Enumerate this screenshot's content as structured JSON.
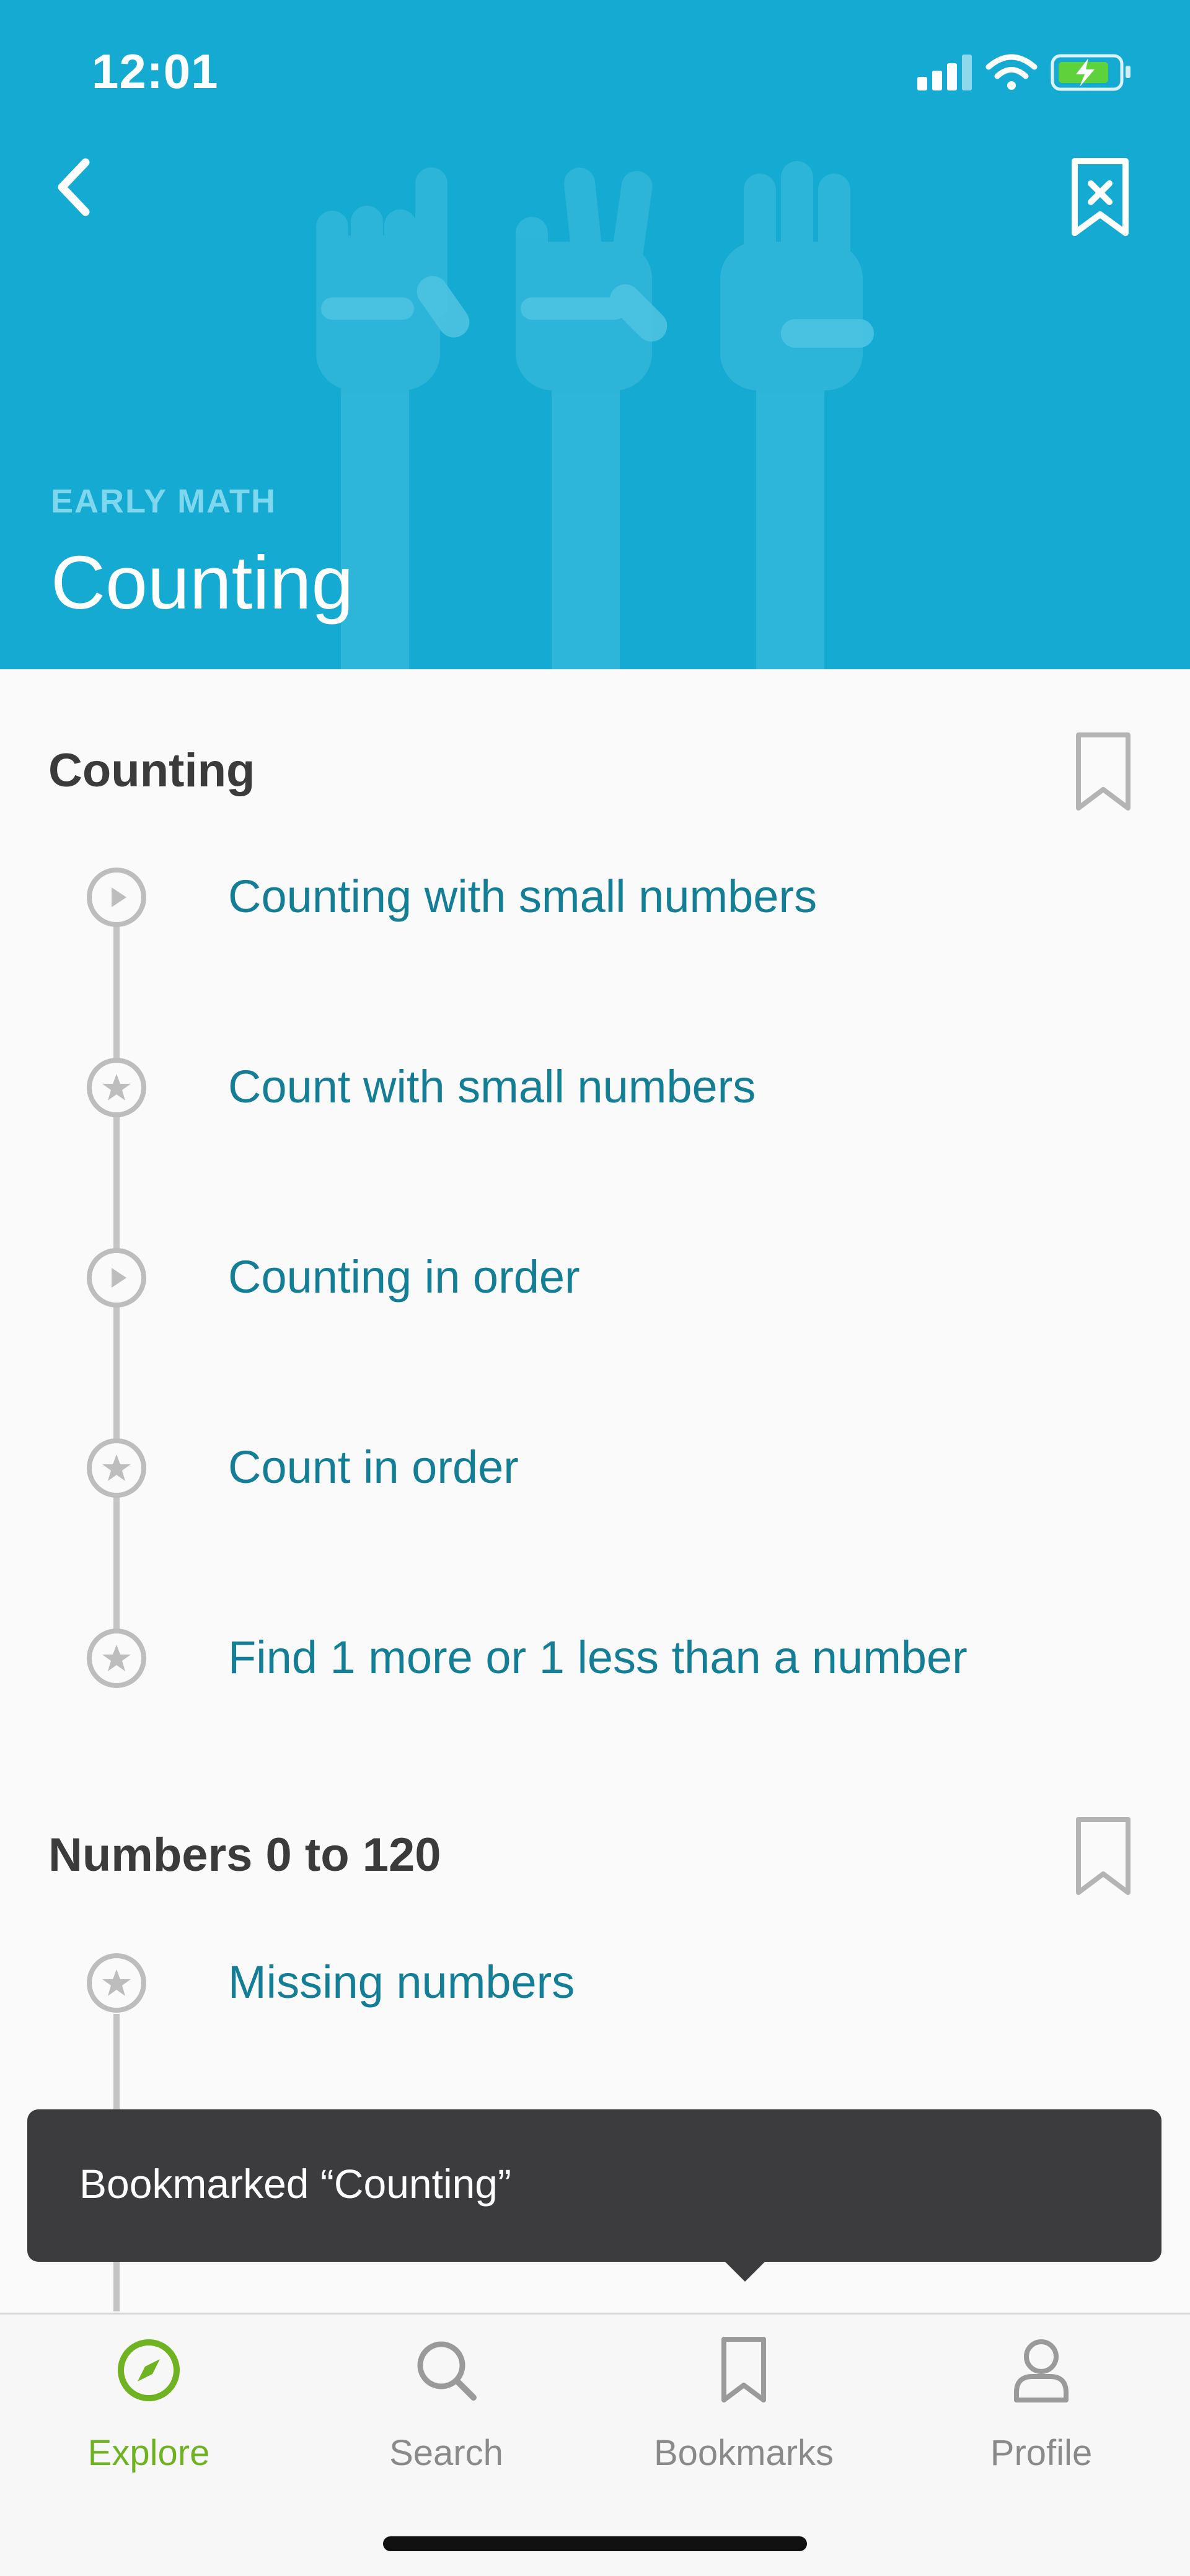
{
  "status_bar": {
    "time": "12:01"
  },
  "header": {
    "subject": "EARLY MATH",
    "title": "Counting"
  },
  "sections": [
    {
      "title": "Counting",
      "items": [
        {
          "label": "Counting with small numbers",
          "type": "video"
        },
        {
          "label": "Count with small numbers",
          "type": "exercise"
        },
        {
          "label": "Counting in order",
          "type": "video"
        },
        {
          "label": "Count in order",
          "type": "exercise"
        },
        {
          "label": "Find 1 more or 1 less than a number",
          "type": "exercise"
        }
      ]
    },
    {
      "title": "Numbers 0 to 120",
      "items": [
        {
          "label": "Missing numbers",
          "type": "exercise"
        }
      ]
    }
  ],
  "toast": {
    "text": "Bookmarked “Counting”"
  },
  "tabbar": {
    "tabs": [
      {
        "label": "Explore",
        "icon": "compass-icon",
        "active": true
      },
      {
        "label": "Search",
        "icon": "search-icon",
        "active": false
      },
      {
        "label": "Bookmarks",
        "icon": "bookmark-icon",
        "active": false
      },
      {
        "label": "Profile",
        "icon": "person-icon",
        "active": false
      }
    ]
  },
  "colors": {
    "header_bg": "#14aad2",
    "link": "#137e95",
    "active_tab": "#6fb323",
    "toast_bg": "#3c3c3e"
  }
}
